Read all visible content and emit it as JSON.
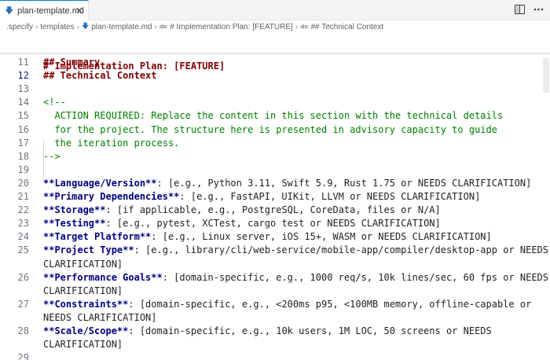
{
  "tab": {
    "filename": "plan-template.md",
    "close_glyph": "×",
    "file_icon": "markdown-download-icon"
  },
  "toolbar": {
    "split_icon": "split-editor-icon",
    "more_icon": "more-actions-icon"
  },
  "breadcrumb": {
    "folder1": ".specify",
    "folder2": "templates",
    "file": "plan-template.md",
    "symbol1": "# Implementation Plan: [FEATURE]",
    "symbol2": "## Technical Context",
    "separator": "›",
    "symbol_prefix": "abc"
  },
  "editor": {
    "sticky_line": "# Implementation Plan: [FEATURE]",
    "sticky_line2": "## Summary",
    "lines": [
      {
        "n": "11",
        "text": ""
      },
      {
        "n": "12",
        "text": "## Technical Context"
      },
      {
        "n": "13",
        "text": ""
      },
      {
        "n": "14",
        "text": "<!--"
      },
      {
        "n": "15",
        "text": "  ACTION REQUIRED: Replace the content in this section with the technical details"
      },
      {
        "n": "16",
        "text": "  for the project. The structure here is presented in advisory capacity to guide"
      },
      {
        "n": "17",
        "text": "  the iteration process."
      },
      {
        "n": "18",
        "text": "-->"
      },
      {
        "n": "19",
        "text": ""
      },
      {
        "n": "20",
        "bold": "**Language/Version**",
        "rest": ": [e.g., Python 3.11, Swift 5.9, Rust 1.75 or NEEDS CLARIFICATION]"
      },
      {
        "n": "21",
        "bold": "**Primary Dependencies**",
        "rest": ": [e.g., FastAPI, UIKit, LLVM or NEEDS CLARIFICATION]"
      },
      {
        "n": "22",
        "bold": "**Storage**",
        "rest": ": [if applicable, e.g., PostgreSQL, CoreData, files or N/A]"
      },
      {
        "n": "23",
        "bold": "**Testing**",
        "rest": ": [e.g., pytest, XCTest, cargo test or NEEDS CLARIFICATION]"
      },
      {
        "n": "24",
        "bold": "**Target Platform**",
        "rest": ": [e.g., Linux server, iOS 15+, WASM or NEEDS CLARIFICATION]"
      },
      {
        "n": "25",
        "bold": "**Project Type**",
        "rest": ": [e.g., library/cli/web-service/mobile-app/compiler/desktop-app or NEEDS",
        "wrap": "CLARIFICATION]"
      },
      {
        "n": "26",
        "bold": "**Performance Goals**",
        "rest": ": [domain-specific, e.g., 1000 req/s, 10k lines/sec, 60 fps or NEEDS",
        "wrap": "CLARIFICATION]"
      },
      {
        "n": "27",
        "bold": "**Constraints**",
        "rest": ": [domain-specific, e.g., <200ms p95, <100MB memory, offline-capable or",
        "wrap": "NEEDS CLARIFICATION]"
      },
      {
        "n": "28",
        "bold": "**Scale/Scope**",
        "rest": ": [domain-specific, e.g., 10k users, 1M LOC, 50 screens or NEEDS",
        "wrap": "CLARIFICATION]"
      },
      {
        "n": "29",
        "text": ""
      }
    ]
  }
}
